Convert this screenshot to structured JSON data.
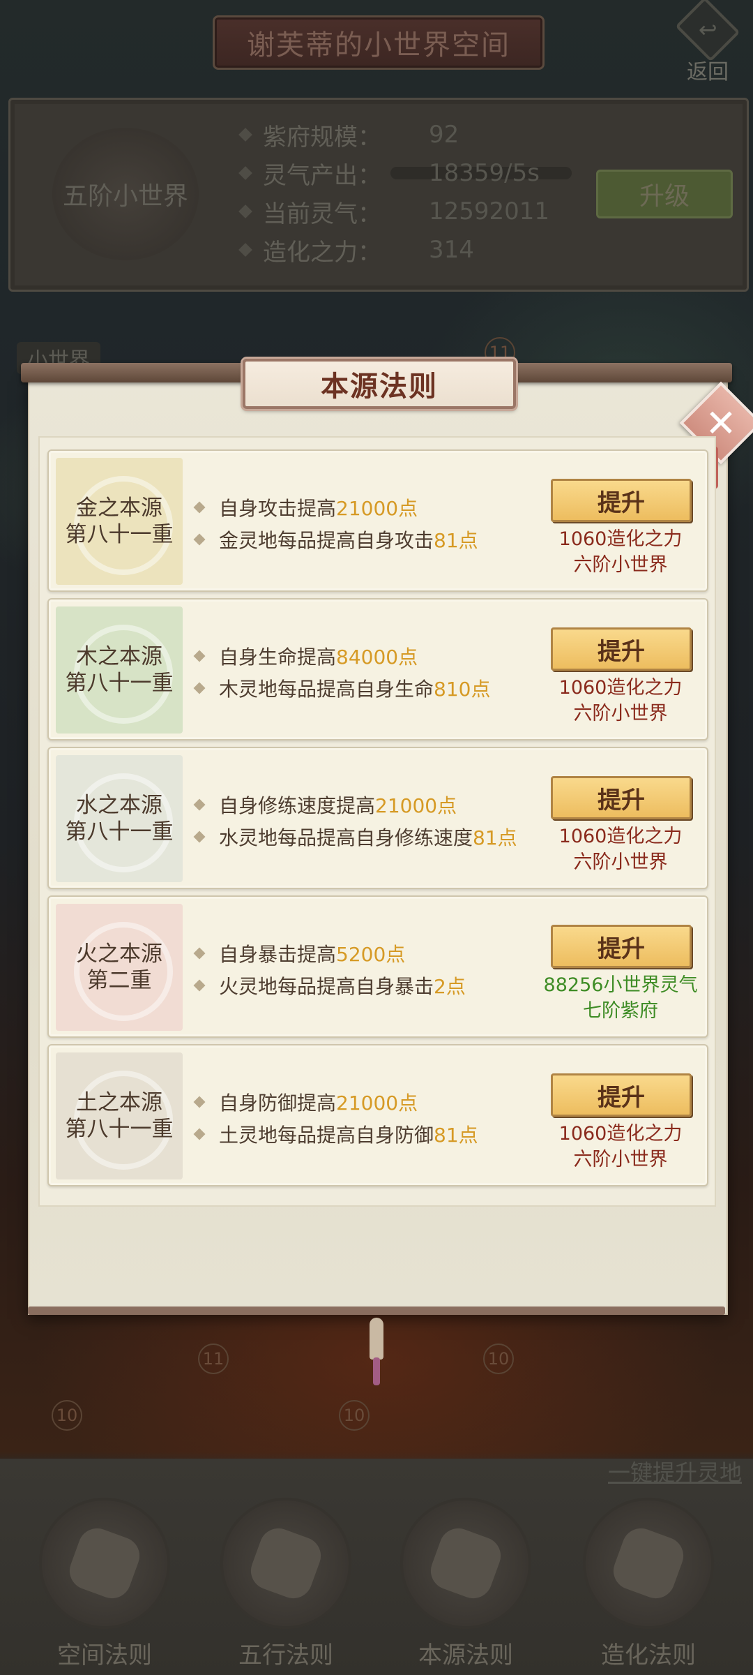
{
  "header": {
    "title": "谢芙蒂的小世界空间",
    "back_label": "返回"
  },
  "info_panel": {
    "world_level": "五阶小世界",
    "stats": [
      {
        "label": "紫府规模：",
        "value": "92"
      },
      {
        "label": "灵气产出：",
        "value": "18359/5s"
      },
      {
        "label": "当前灵气：",
        "value": "12592011"
      },
      {
        "label": "造化之力：",
        "value": "314"
      }
    ],
    "upgrade_label": "升级"
  },
  "sub_tab_label": "小世界",
  "map_numbers": [
    "11",
    "11",
    "10",
    "10",
    "10"
  ],
  "one_key_link": "一键提升灵地",
  "modal": {
    "title": "本源法则",
    "cards": [
      {
        "name_line1": "金之本源",
        "name_line2": "第八十一重",
        "effect1_text": "自身攻击提高",
        "effect1_value": "21000点",
        "effect2_text": "金灵地每品提高自身攻击",
        "effect2_value": "81点",
        "button_label": "提升",
        "req_line1": "1060造化之力",
        "req_line2": "六阶小世界",
        "req_color": "#8a2a1c",
        "icon_tint": "#ece3bd"
      },
      {
        "name_line1": "木之本源",
        "name_line2": "第八十一重",
        "effect1_text": "自身生命提高",
        "effect1_value": "84000点",
        "effect2_text": "木灵地每品提高自身生命",
        "effect2_value": "810点",
        "button_label": "提升",
        "req_line1": "1060造化之力",
        "req_line2": "六阶小世界",
        "req_color": "#8a2a1c",
        "icon_tint": "#d7e3c6"
      },
      {
        "name_line1": "水之本源",
        "name_line2": "第八十一重",
        "effect1_text": "自身修练速度提高",
        "effect1_value": "21000点",
        "effect2_text": "水灵地每品提高自身修练速度",
        "effect2_value": "81点",
        "button_label": "提升",
        "req_line1": "1060造化之力",
        "req_line2": "六阶小世界",
        "req_color": "#8a2a1c",
        "icon_tint": "#e4e6da"
      },
      {
        "name_line1": "火之本源",
        "name_line2": "第二重",
        "effect1_text": "自身暴击提高",
        "effect1_value": "5200点",
        "effect2_text": "火灵地每品提高自身暴击",
        "effect2_value": "2点",
        "button_label": "提升",
        "req_line1": "88256小世界灵气",
        "req_line2": "七阶紫府",
        "req_color": "#3e8c25",
        "icon_tint": "#f1dcd3"
      },
      {
        "name_line1": "土之本源",
        "name_line2": "第八十一重",
        "effect1_text": "自身防御提高",
        "effect1_value": "21000点",
        "effect2_text": "土灵地每品提高自身防御",
        "effect2_value": "81点",
        "button_label": "提升",
        "req_line1": "1060造化之力",
        "req_line2": "六阶小世界",
        "req_color": "#8a2a1c",
        "icon_tint": "#e6e0d2"
      }
    ]
  },
  "bottom_nav": [
    {
      "label": "空间法则",
      "icon": "space-law-icon"
    },
    {
      "label": "五行法则",
      "icon": "five-elements-icon"
    },
    {
      "label": "本源法则",
      "icon": "origin-law-icon"
    },
    {
      "label": "造化法则",
      "icon": "creation-law-icon"
    }
  ],
  "colors": {
    "highlight_value": "#d69a25",
    "requirement_red": "#8a2a1c",
    "requirement_green": "#3e8c25",
    "title_text": "#6c3222"
  }
}
